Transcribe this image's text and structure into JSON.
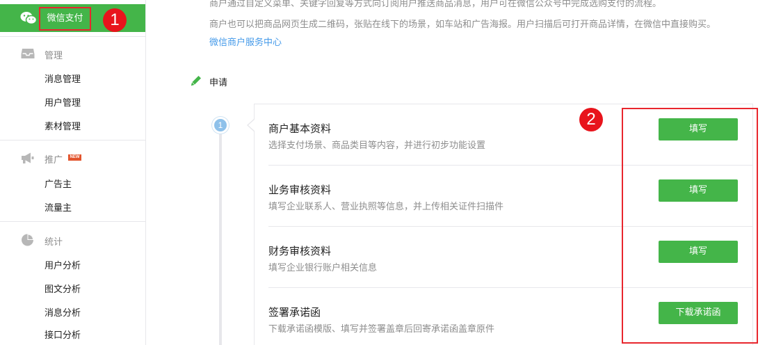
{
  "sidebar": {
    "active": {
      "label": "微信支付",
      "icon": "wechat-icon"
    },
    "groups": [
      {
        "title": "管理",
        "icon": "inbox-icon",
        "items": [
          "消息管理",
          "用户管理",
          "素材管理"
        ]
      },
      {
        "title": "推广",
        "icon": "megaphone-icon",
        "new_tag": "NEW",
        "items": [
          "广告主",
          "流量主"
        ]
      },
      {
        "title": "统计",
        "icon": "pie-chart-icon",
        "items": [
          "用户分析",
          "图文分析",
          "消息分析",
          "接口分析"
        ]
      }
    ]
  },
  "annotations": {
    "badge1": "1",
    "badge2": "2",
    "highlight_color": "#e8262d"
  },
  "intro": {
    "line1": "商户通过自定义菜单、关键字回复等方式向订阅用户推送商品消息，用户可在微信公众号中完成选购支付的流程。",
    "line2": "商户也可以把商品网页生成二维码，张贴在线下的场景，如车站和广告海报。用户扫描后可打开商品详情，在微信中直接购买。",
    "link": "微信商户服务中心"
  },
  "apply": {
    "title": "申请",
    "icon": "pencil-icon",
    "step_number": "1",
    "rows": [
      {
        "title": "商户基本资料",
        "desc": "选择支付场景、商品类目等内容，并进行初步功能设置",
        "button": "填写"
      },
      {
        "title": "业务审核资料",
        "desc": "填写企业联系人、营业执照等信息，并上传相关证件扫描件",
        "button": "填写"
      },
      {
        "title": "财务审核资料",
        "desc": "填写企业银行账户相关信息",
        "button": "填写"
      },
      {
        "title": "签署承诺函",
        "desc": "下载承诺函模版、填写并签署盖章后回寄承诺函盖章原件",
        "button": "下载承诺函"
      }
    ]
  },
  "colors": {
    "brand_green": "#44b549",
    "link_blue": "#459ae9",
    "text_gray": "#8d8d8d",
    "step_blue": "#8ec1ea"
  }
}
